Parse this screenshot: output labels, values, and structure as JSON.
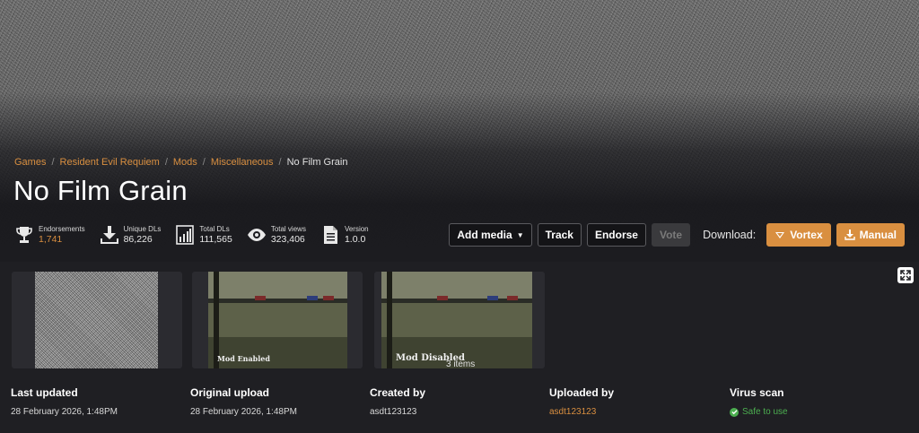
{
  "breadcrumb": {
    "items": [
      "Games",
      "Resident Evil Requiem",
      "Mods",
      "Miscellaneous"
    ],
    "current": "No Film Grain",
    "separator": "/"
  },
  "title": "No Film Grain",
  "stats": {
    "endorsements": {
      "label": "Endorsements",
      "value": "1,741",
      "icon": "trophy-icon"
    },
    "unique_dls": {
      "label": "Unique DLs",
      "value": "86,226",
      "icon": "download-icon"
    },
    "total_dls": {
      "label": "Total DLs",
      "value": "111,565",
      "icon": "bar-chart-icon"
    },
    "total_views": {
      "label": "Total views",
      "value": "323,406",
      "icon": "eye-icon"
    },
    "version": {
      "label": "Version",
      "value": "1.0.0",
      "icon": "document-icon"
    }
  },
  "actions": {
    "add_media": "Add media",
    "track": "Track",
    "endorse": "Endorse",
    "vote": "Vote",
    "download_label": "Download:",
    "vortex": "Vortex",
    "manual": "Manual"
  },
  "gallery": {
    "captions": [
      "Mod Enabled",
      "Mod Disabled"
    ],
    "items_count": "3 items"
  },
  "meta": {
    "last_updated": {
      "label": "Last updated",
      "value": "28 February 2026, 1:48PM"
    },
    "original_upload": {
      "label": "Original upload",
      "value": "28 February 2026, 1:48PM"
    },
    "created_by": {
      "label": "Created by",
      "value": "asdt123123"
    },
    "uploaded_by": {
      "label": "Uploaded by",
      "value": "asdt123123"
    },
    "virus_scan": {
      "label": "Virus scan",
      "value": "Safe to use"
    }
  },
  "colors": {
    "accent": "#d98f40",
    "background": "#1f1f23",
    "safe": "#4caf50"
  }
}
